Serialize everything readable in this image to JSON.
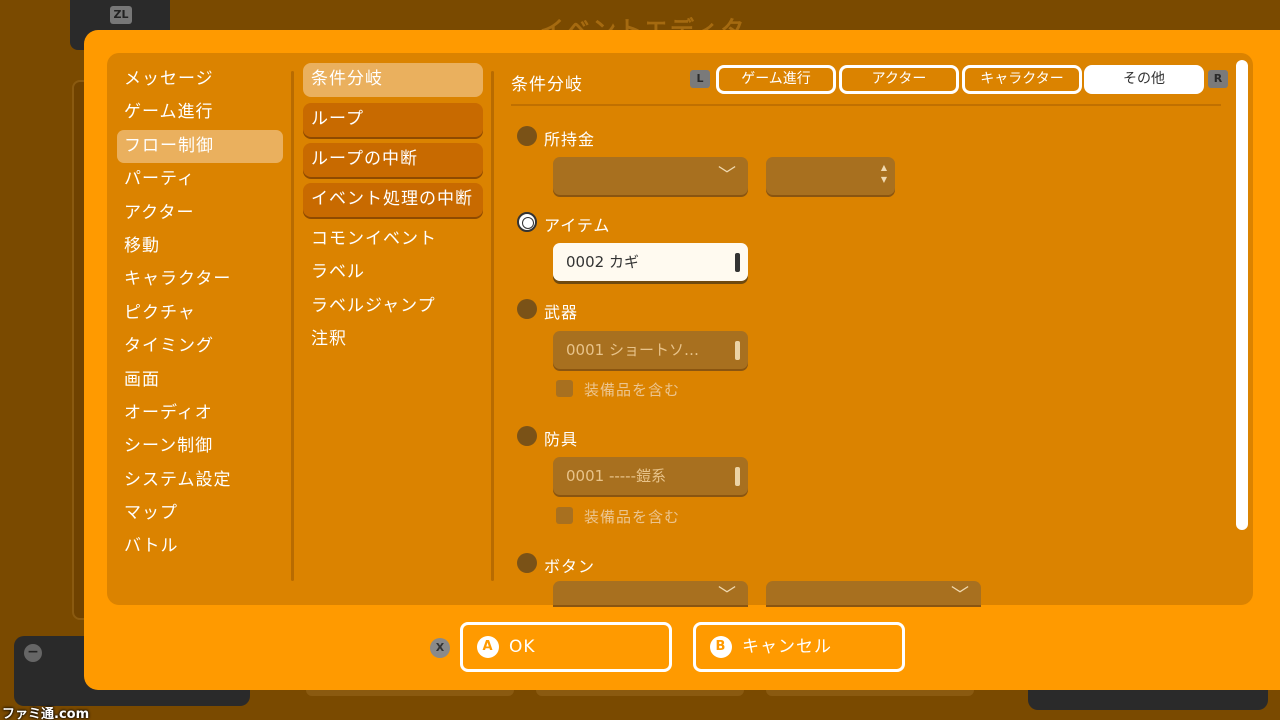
{
  "background": {
    "title": "イベントエディタ",
    "zl_key": "ZL",
    "minus_key": "−",
    "watermark": "ファミ通.com"
  },
  "categories": [
    "メッセージ",
    "ゲーム進行",
    "フロー制御",
    "パーティ",
    "アクター",
    "移動",
    "キャラクター",
    "ピクチャ",
    "タイミング",
    "画面",
    "オーディオ",
    "シーン制御",
    "システム設定",
    "マップ",
    "バトル"
  ],
  "active_category": "フロー制御",
  "commands": [
    "条件分岐",
    "ループ",
    "ループの中断",
    "イベント処理の中断",
    "コモンイベント",
    "ラベル",
    "ラベルジャンプ",
    "注釈"
  ],
  "selected_command": "条件分岐",
  "panel": {
    "title": "条件分岐",
    "l_key": "L",
    "r_key": "R",
    "tabs": [
      "ゲーム進行",
      "アクター",
      "キャラクター",
      "その他"
    ],
    "active_tab": "その他",
    "options": {
      "money": {
        "label": "所持金",
        "selected": false
      },
      "item": {
        "label": "アイテム",
        "selected": true,
        "value": "0002 カギ"
      },
      "weapon": {
        "label": "武器",
        "selected": false,
        "value": "0001 ショートソ…",
        "check_label": "装備品を含む"
      },
      "armor": {
        "label": "防具",
        "selected": false,
        "value": "0001 -----鎧系",
        "check_label": "装備品を含む"
      },
      "button": {
        "label": "ボタン",
        "selected": false
      }
    }
  },
  "footer": {
    "x_key": "X",
    "ok_key": "A",
    "ok_label": "OK",
    "cancel_key": "B",
    "cancel_label": "キャンセル"
  },
  "colors": {
    "dialog": "#ff9a00",
    "inner": "#db8300",
    "highlight": "#eab05e",
    "backdrop": "#7a4a00"
  }
}
